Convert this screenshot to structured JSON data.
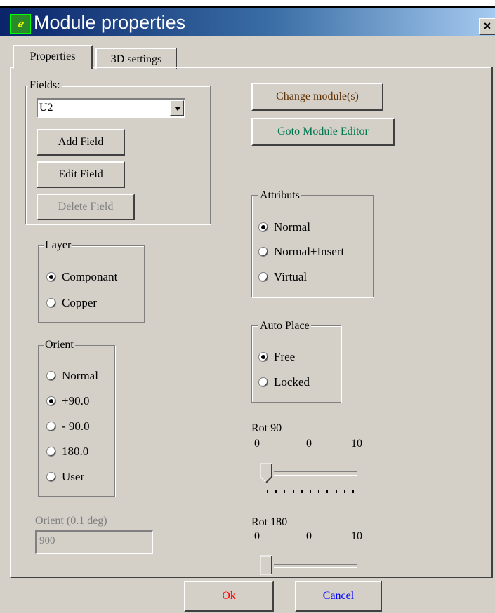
{
  "window": {
    "title": "Module properties",
    "close_label": "×"
  },
  "tabs": [
    {
      "label": "Properties",
      "active": true
    },
    {
      "label": "3D settings",
      "active": false
    }
  ],
  "fields": {
    "legend": "Fields:",
    "selected_value": "U2",
    "add_label": "Add Field",
    "edit_label": "Edit Field",
    "delete_label": "Delete Field"
  },
  "layer": {
    "legend": "Layer",
    "options": [
      "Componant",
      "Copper"
    ],
    "selected": 0
  },
  "orient": {
    "legend": "Orient",
    "options": [
      "Normal",
      "+90.0",
      "- 90.0",
      "180.0",
      "User"
    ],
    "selected": 1
  },
  "orient_deg": {
    "label": "Orient (0.1 deg)",
    "value": "900"
  },
  "buttons": {
    "change_module": "Change module(s)",
    "goto_editor": "Goto Module Editor",
    "change_color": "#603000",
    "goto_color": "#007850"
  },
  "attributs": {
    "legend": "Attributs",
    "options": [
      "Normal",
      "Normal+Insert",
      "Virtual"
    ],
    "selected": 0
  },
  "auto_place": {
    "legend": "Auto Place",
    "options": [
      "Free",
      "Locked"
    ],
    "selected": 0
  },
  "rot90": {
    "label": "Rot 90",
    "min": "0",
    "value": "0",
    "max": "10"
  },
  "rot180": {
    "label": "Rot 180",
    "min": "0",
    "value": "0",
    "max": "10"
  },
  "footer": {
    "ok_label": "Ok",
    "cancel_label": "Cancel",
    "ok_color": "#ff0000",
    "cancel_color": "#0000ff"
  }
}
